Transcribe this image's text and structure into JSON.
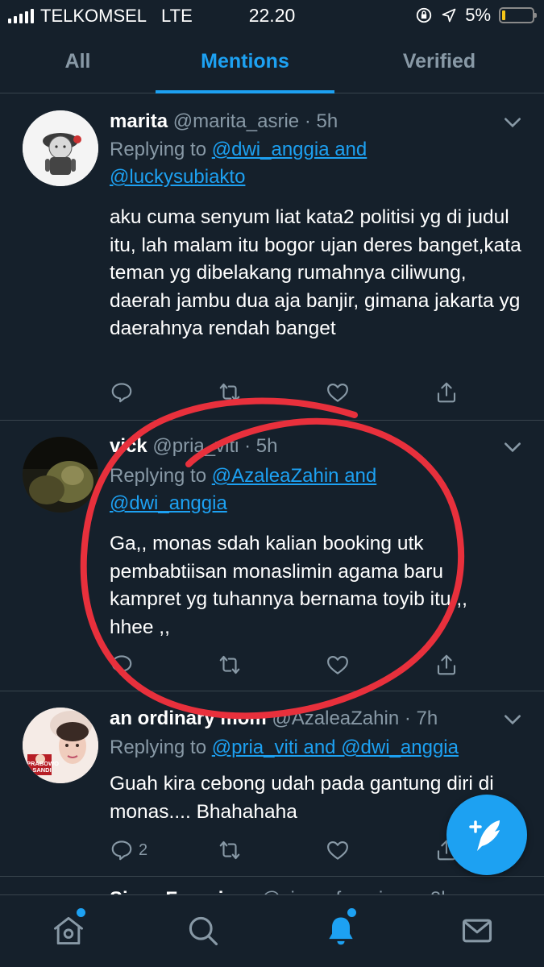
{
  "status_bar": {
    "carrier": "TELKOMSEL",
    "network": "LTE",
    "time": "22.20",
    "battery": "5%"
  },
  "tabs": [
    {
      "label": "All",
      "active": false
    },
    {
      "label": "Mentions",
      "active": true
    },
    {
      "label": "Verified",
      "active": false
    }
  ],
  "tweets": [
    {
      "name": "marita",
      "handle": "@marita_asrie",
      "time": "5h",
      "replying_prefix": "Replying to ",
      "reply_line1": "@dwi_anggia and",
      "reply_line2": "@luckysubiakto",
      "body": "aku cuma senyum liat kata2 politisi yg di judul itu, lah malam itu bogor ujan deres banget,kata teman yg dibelakang rumahnya ciliwung, daerah jambu dua aja banjir, gimana jakarta yg daerahnya rendah banget",
      "reply_count": ""
    },
    {
      "name": "vick",
      "handle": "@pria_viti",
      "time": "5h",
      "replying_prefix": "Replying to ",
      "reply_line1": "@AzaleaZahin and",
      "reply_line2": "@dwi_anggia",
      "body": "Ga,, monas sdah kalian booking utk pembabtiisan monaslimin agama baru kampret yg tuhannya bernama toyib itu ,, hhee ,,",
      "reply_count": ""
    },
    {
      "name": "an ordinary mom",
      "handle": "@AzaleaZahin",
      "time": "7h",
      "replying_prefix": "Replying to ",
      "reply_line1": "@pria_viti and @dwi_anggia",
      "reply_line2": "",
      "body": "Guah kira cebong udah pada gantung diri di monas.... Bhahahaha",
      "reply_count": "2",
      "avatar_text": "PRABOWO SANDI"
    }
  ],
  "partial_tweet": {
    "name": "Sisca Fransisca",
    "handle": "@sisca_fransisca",
    "time": "8h"
  },
  "colors": {
    "background": "#15202b",
    "accent": "#1da1f2",
    "muted": "#8899a6",
    "divider": "#38444d",
    "annotation": "#e8303c"
  },
  "icons": {
    "compose": "feather-plus-icon",
    "home": "home-icon",
    "search": "search-icon",
    "notifications": "bell-icon",
    "messages": "mail-icon"
  }
}
